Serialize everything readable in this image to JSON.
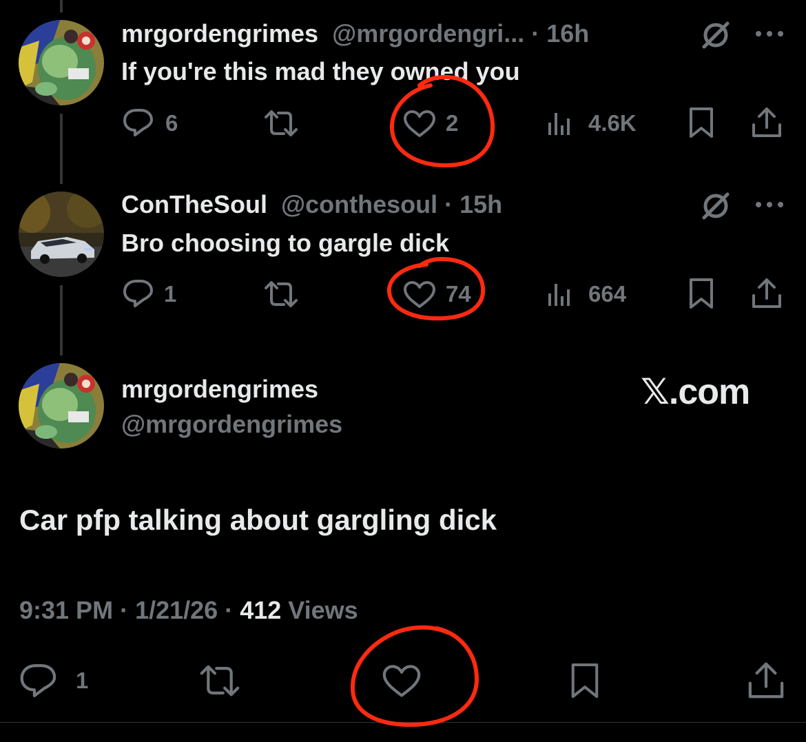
{
  "reply1": {
    "display_name": "mrgordengrimes",
    "handle": "@mrgordengri...",
    "separator": " · ",
    "time": "16h",
    "text": "If you're this mad they owned you",
    "replies": "6",
    "likes": "2",
    "views": "4.6K"
  },
  "reply2": {
    "display_name": "ConTheSoul",
    "handle": "@conthesoul",
    "separator": " · ",
    "time": "15h",
    "text": "Bro choosing to gargle dick",
    "replies": "1",
    "likes": "74",
    "views": "664"
  },
  "main": {
    "display_name": "mrgordengrimes",
    "handle": "@mrgordengrimes",
    "watermark": "𝕏.com",
    "text": "Car pfp talking about gargling dick",
    "time": "9:31 PM",
    "date": "1/21/26",
    "dot": " · ",
    "views_count": "412",
    "views_label": " Views",
    "replies": "1"
  },
  "colors": {
    "background": "#000000",
    "text_primary": "#e7e9ea",
    "text_secondary": "#71767b",
    "annotation_red": "#ff2a10",
    "thread_line": "#333639"
  },
  "icons": {
    "reply": "reply-icon",
    "repost": "repost-icon",
    "like": "heart-icon",
    "views": "views-icon",
    "bookmark": "bookmark-icon",
    "share": "share-icon",
    "grok": "grok-icon",
    "more": "more-icon"
  }
}
